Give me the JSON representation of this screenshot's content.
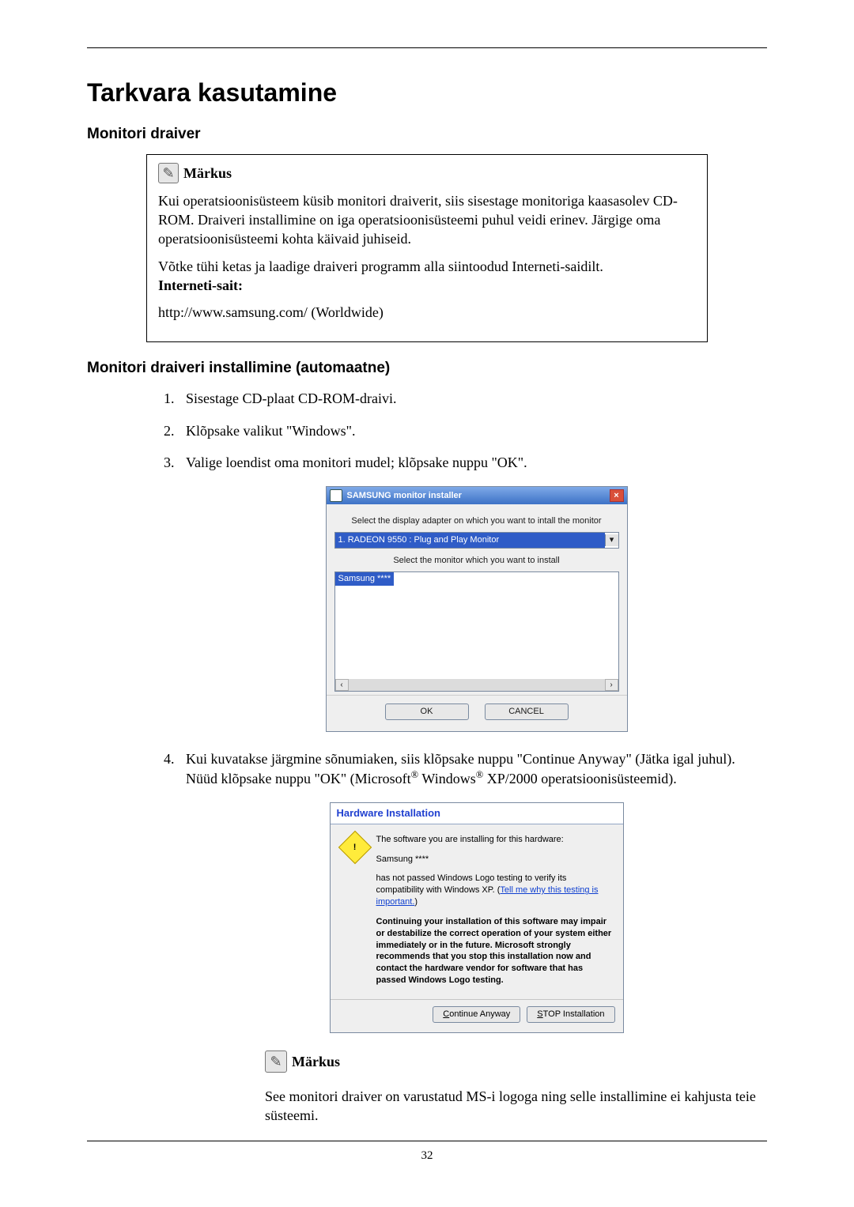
{
  "doc": {
    "title": "Tarkvara kasutamine",
    "section1": "Monitori draiver",
    "note": {
      "label": "Märkus",
      "p1": "Kui operatsioonisüsteem küsib monitori draiverit, siis sisestage monitoriga kaasasolev CD-ROM. Draiveri installimine on iga operatsioonisüsteemi puhul veidi erinev. Järgige oma operatsioonisüsteemi kohta käivaid juhiseid.",
      "p2": "Võtke tühi ketas ja laadige draiveri programm alla siintoodud Interneti-saidilt.",
      "label_site": "Interneti-sait:",
      "url": "http://www.samsung.com/ (Worldwide)"
    },
    "section2": "Monitori draiveri installimine (automaatne)",
    "steps": {
      "s1": "Sisestage CD-plaat CD-ROM-draivi.",
      "s2": "Klõpsake valikut \"Windows\".",
      "s3": "Valige loendist oma monitori mudel; klõpsake nuppu \"OK\".",
      "s4a": "Kui kuvatakse järgmine sõnumiaken, siis klõpsake nuppu \"Continue Anyway\" (Jätka igal juhul). Nüüd klõpsake nuppu \"OK\" (Microsoft",
      "s4b": " Windows",
      "s4c": " XP/2000 operatsioonisüsteemid)."
    },
    "note2": {
      "label": "Märkus",
      "text": "See monitori draiver on varustatud MS-i logoga ning selle installimine ei kahjusta teie süsteemi."
    },
    "page": "32"
  },
  "dlg1": {
    "title": "SAMSUNG monitor installer",
    "close": "×",
    "line1": "Select the display adapter on which you want to intall the monitor",
    "combo": "1. RADEON 9550 : Plug and Play Monitor",
    "arrow": "▾",
    "line2": "Select the monitor which you want to install",
    "list_sel": "Samsung ****",
    "hs_left": "‹",
    "hs_right": "›",
    "btn_ok": "OK",
    "btn_cancel": "CANCEL"
  },
  "dlg2": {
    "title": "Hardware Installation",
    "warn": "!",
    "p1": "The software you are installing for this hardware:",
    "p2": "Samsung ****",
    "p3a": "has not passed Windows Logo testing to verify its compatibility with Windows XP. (",
    "p3b": "Tell me why this testing is important.",
    "p3c": ")",
    "p4": "Continuing your installation of this software may impair or destabilize the correct operation of your system either immediately or in the future. Microsoft strongly recommends that you stop this installation now and contact the hardware vendor for software that has passed Windows Logo testing.",
    "btn_continue": "Continue Anyway",
    "btn_stop": "STOP Installation"
  }
}
